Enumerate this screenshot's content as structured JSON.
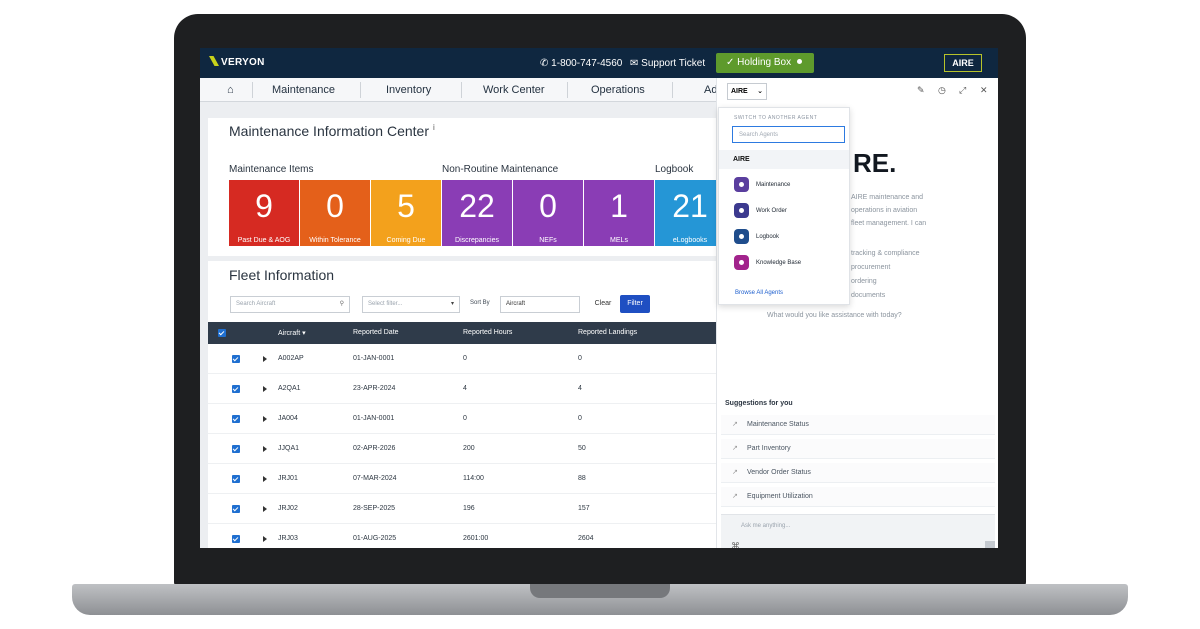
{
  "topbar": {
    "logo": "VERYON",
    "phone": "1-800-747-4560",
    "support": "Support Ticket",
    "holding": "Holding Box",
    "aire_badge": "AIRE"
  },
  "nav": {
    "items": [
      "Maintenance",
      "Inventory",
      "Work Center",
      "Operations",
      "Ad"
    ]
  },
  "mic": {
    "title": "Maintenance Information Center",
    "groups": [
      "Maintenance Items",
      "Non-Routine Maintenance",
      "Logbook"
    ],
    "tiles": [
      {
        "value": "9",
        "label": "Past Due & AOG",
        "color": "#d62a22"
      },
      {
        "value": "0",
        "label": "Within Tolerance",
        "color": "#e4601a"
      },
      {
        "value": "5",
        "label": "Coming Due",
        "color": "#f3a11c"
      },
      {
        "value": "22",
        "label": "Discrepancies",
        "color": "#8a3db5"
      },
      {
        "value": "0",
        "label": "NEFs",
        "color": "#8a3db5"
      },
      {
        "value": "1",
        "label": "MELs",
        "color": "#8a3db5"
      },
      {
        "value": "21",
        "label": "eLogbooks",
        "color": "#2596d6"
      }
    ]
  },
  "fleet": {
    "title": "Fleet Information",
    "search_placeholder": "Search Aircraft",
    "filter_placeholder": "Select filter...",
    "sort_label": "Sort By",
    "sort_value": "Aircraft",
    "clear": "Clear",
    "filter": "Filter",
    "columns": [
      "Aircraft",
      "Reported Date",
      "Reported Hours",
      "Reported Landings"
    ],
    "rows": [
      {
        "aircraft": "A002AP",
        "date": "01-JAN-0001",
        "hours": "0",
        "landings": "0"
      },
      {
        "aircraft": "A2QA1",
        "date": "23-APR-2024",
        "hours": "4",
        "landings": "4"
      },
      {
        "aircraft": "JA004",
        "date": "01-JAN-0001",
        "hours": "0",
        "landings": "0"
      },
      {
        "aircraft": "JJQA1",
        "date": "02-APR-2026",
        "hours": "200",
        "landings": "50"
      },
      {
        "aircraft": "JRJ01",
        "date": "07-MAR-2024",
        "hours": "114:00",
        "landings": "88"
      },
      {
        "aircraft": "JRJ02",
        "date": "28-SEP-2025",
        "hours": "196",
        "landings": "157"
      },
      {
        "aircraft": "JRJ03",
        "date": "01-AUG-2025",
        "hours": "2601:00",
        "landings": "2604"
      }
    ]
  },
  "panel": {
    "agent": "AIRE",
    "hero": "RE.",
    "intro_lines": [
      "AIRE maintenance and",
      "operations in aviation",
      "fleet management. I can"
    ],
    "capability_lines": [
      "tracking & compliance",
      "procurement",
      "ordering",
      "documents"
    ],
    "prompt": "What would you like assistance with today?",
    "suggestions_title": "Suggestions for you",
    "suggestions": [
      "Maintenance Status",
      "Part Inventory",
      "Vendor Order Status",
      "Equipment Utilization"
    ],
    "ask_placeholder": "Ask me anything..."
  },
  "dropdown": {
    "header": "SWITCH TO ANOTHER AGENT",
    "search_placeholder": "Search Agents",
    "current": "AIRE",
    "agents": [
      {
        "label": "Maintenance",
        "color": "#5a3e9e"
      },
      {
        "label": "Work Order",
        "color": "#3c3a8f"
      },
      {
        "label": "Logbook",
        "color": "#1f4d8c"
      },
      {
        "label": "Knowledge Base",
        "color": "#a2238c"
      }
    ],
    "browse": "Browse All Agents"
  }
}
